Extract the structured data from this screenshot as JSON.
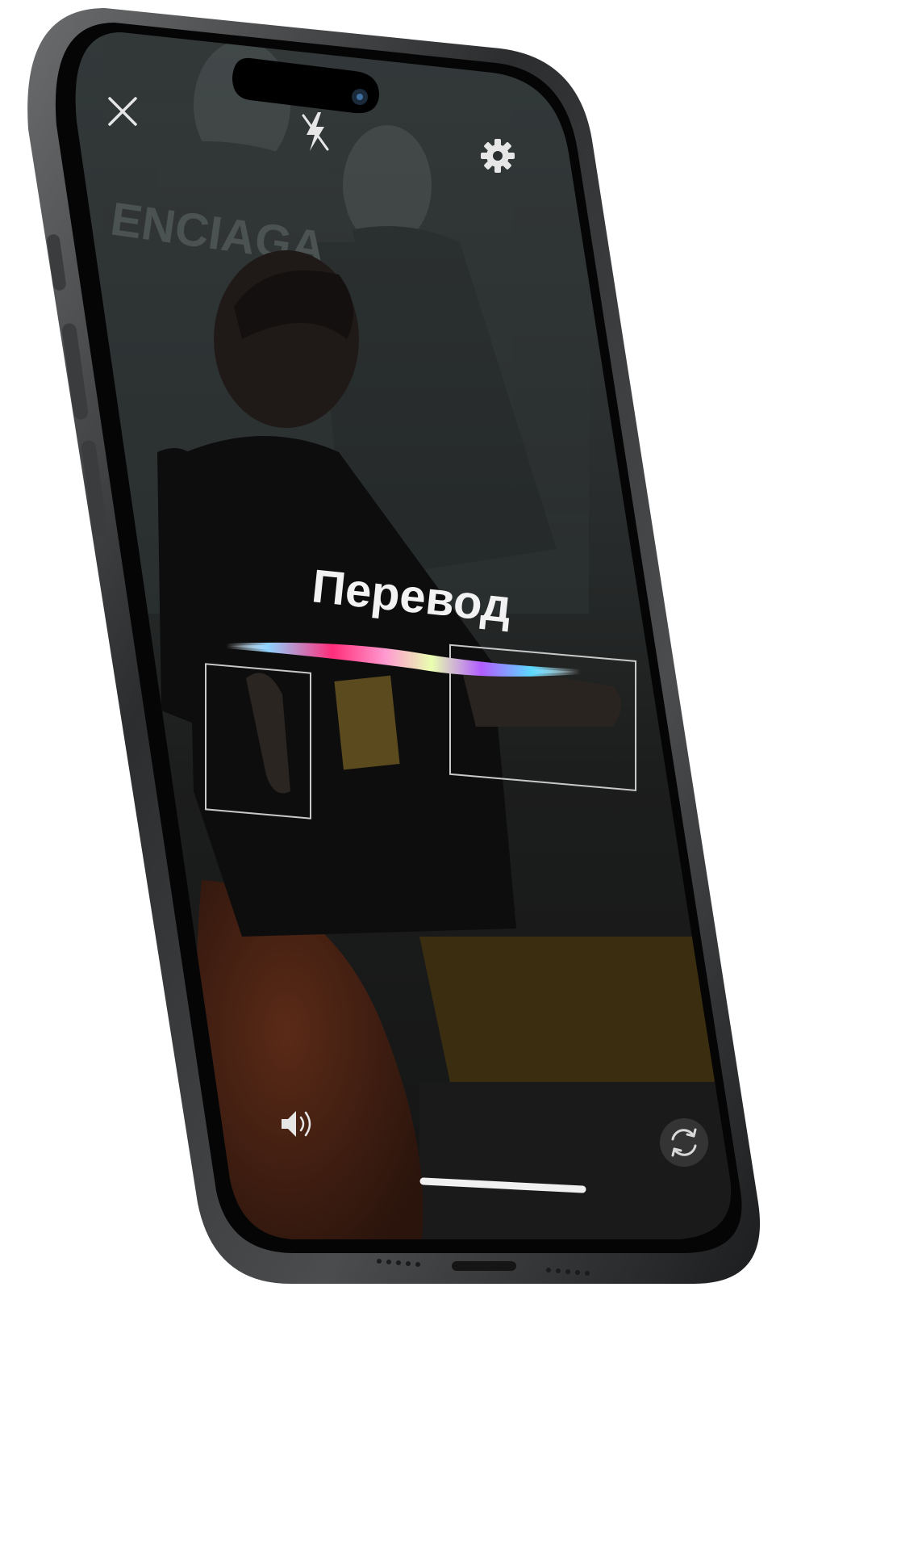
{
  "app": {
    "caption": "Перевод"
  },
  "top_bar": {
    "close_icon": "close-icon",
    "flash_icon": "flash-off-icon",
    "settings_icon": "gear-icon"
  },
  "bottom_bar": {
    "sound_icon": "speaker-icon",
    "switch_camera_icon": "switch-camera-icon"
  },
  "camera_scene": {
    "background_sign_text": "ENCIAGA",
    "detections": [
      {
        "label": "left-hand"
      },
      {
        "label": "right-hand"
      }
    ]
  },
  "colors": {
    "siri_wave": [
      "#3fa9ff",
      "#ff2d7a",
      "#ffd84a",
      "#5cffd0",
      "#b15cff"
    ],
    "frame": "#2a2c2e"
  }
}
